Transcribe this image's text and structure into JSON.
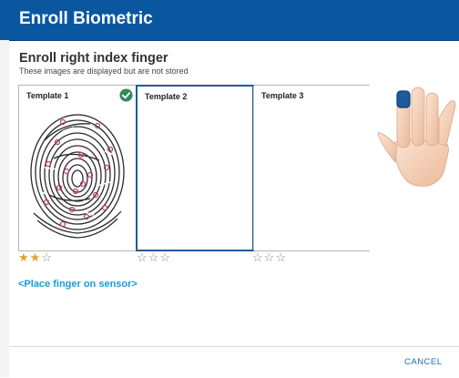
{
  "window": {
    "title": "Enroll Biometric"
  },
  "enroll": {
    "heading": "Enroll right index finger",
    "subheading": "These images are displayed but are not stored",
    "prompt": "<Place finger on sensor>"
  },
  "templates": [
    {
      "label": "Template 1",
      "captured": true,
      "quality_stars": 2,
      "max_stars": 3,
      "status_icon": "check-circle-icon"
    },
    {
      "label": "Template 2",
      "captured": false,
      "selected": true,
      "quality_stars": 0,
      "max_stars": 3
    },
    {
      "label": "Template 3",
      "captured": false,
      "quality_stars": 0,
      "max_stars": 3
    }
  ],
  "hand_illustration": {
    "icon": "right-hand-index-highlight-icon",
    "highlight_color": "#1e5b9a"
  },
  "footer": {
    "cancel_label": "CANCEL"
  },
  "colors": {
    "titlebar": "#0a57a0",
    "accent": "#1a9ad9",
    "selected_border": "#1e5b9a",
    "check": "#2e8b57",
    "star_filled": "#e7a02a"
  }
}
